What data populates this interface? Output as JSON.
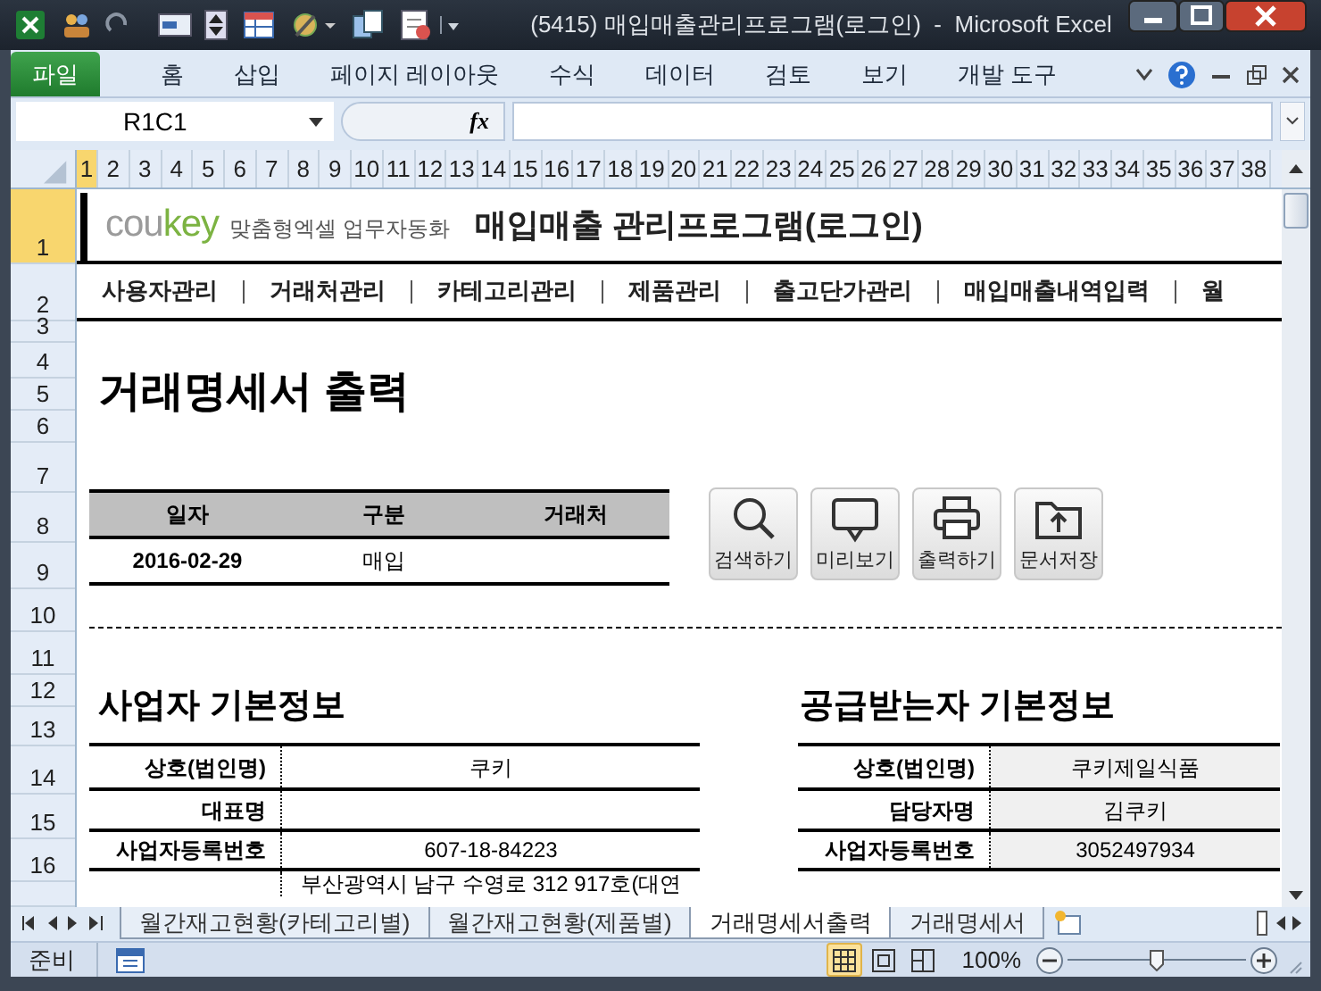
{
  "window": {
    "title": "(5415) 매입매출관리프로그램(로그인)  -  Microsoft Excel"
  },
  "ribbon_tabs": [
    {
      "label": "파일",
      "kind": "file"
    },
    {
      "label": "홈",
      "kind": "tab"
    },
    {
      "label": "삽입",
      "kind": "tab"
    },
    {
      "label": "페이지 레이아웃",
      "kind": "tab"
    },
    {
      "label": "수식",
      "kind": "tab"
    },
    {
      "label": "데이터",
      "kind": "tab"
    },
    {
      "label": "검토",
      "kind": "tab"
    },
    {
      "label": "보기",
      "kind": "tab"
    },
    {
      "label": "개발 도구",
      "kind": "tab"
    }
  ],
  "formula_bar": {
    "name_box": "R1C1",
    "function_label": "fx"
  },
  "column_headers": [
    {
      "label": "1",
      "selected": true
    },
    {
      "label": "2",
      "selected": false
    },
    {
      "label": "3",
      "selected": false
    },
    {
      "label": "4",
      "selected": false
    },
    {
      "label": "5",
      "selected": false
    },
    {
      "label": "6",
      "selected": false
    },
    {
      "label": "7",
      "selected": false
    },
    {
      "label": "8",
      "selected": false
    },
    {
      "label": "9",
      "selected": false
    },
    {
      "label": "10",
      "selected": false
    },
    {
      "label": "11",
      "selected": false
    },
    {
      "label": "12",
      "selected": false
    },
    {
      "label": "13",
      "selected": false
    },
    {
      "label": "14",
      "selected": false
    },
    {
      "label": "15",
      "selected": false
    },
    {
      "label": "16",
      "selected": false
    },
    {
      "label": "17",
      "selected": false
    },
    {
      "label": "18",
      "selected": false
    },
    {
      "label": "19",
      "selected": false
    },
    {
      "label": "20",
      "selected": false
    },
    {
      "label": "21",
      "selected": false
    },
    {
      "label": "22",
      "selected": false
    },
    {
      "label": "23",
      "selected": false
    },
    {
      "label": "24",
      "selected": false
    },
    {
      "label": "25",
      "selected": false
    },
    {
      "label": "26",
      "selected": false
    },
    {
      "label": "27",
      "selected": false
    },
    {
      "label": "28",
      "selected": false
    },
    {
      "label": "29",
      "selected": false
    },
    {
      "label": "30",
      "selected": false
    },
    {
      "label": "31",
      "selected": false
    },
    {
      "label": "32",
      "selected": false
    },
    {
      "label": "33",
      "selected": false
    },
    {
      "label": "34",
      "selected": false
    },
    {
      "label": "35",
      "selected": false
    },
    {
      "label": "36",
      "selected": false
    },
    {
      "label": "37",
      "selected": false
    },
    {
      "label": "38",
      "selected": false
    }
  ],
  "row_headers": [
    {
      "label": "1",
      "selected": true
    },
    {
      "label": "2",
      "selected": false
    },
    {
      "label": "3",
      "selected": false
    },
    {
      "label": "4",
      "selected": false
    },
    {
      "label": "5",
      "selected": false
    },
    {
      "label": "6",
      "selected": false
    },
    {
      "label": "7",
      "selected": false
    },
    {
      "label": "8",
      "selected": false
    },
    {
      "label": "9",
      "selected": false
    },
    {
      "label": "10",
      "selected": false
    },
    {
      "label": "11",
      "selected": false
    },
    {
      "label": "12",
      "selected": false
    },
    {
      "label": "13",
      "selected": false
    },
    {
      "label": "14",
      "selected": false
    },
    {
      "label": "15",
      "selected": false
    },
    {
      "label": "16",
      "selected": false
    }
  ],
  "sheet": {
    "logo": {
      "brand_prefix": "cou",
      "brand_suffix": "key",
      "tagline": "맞춤형엑셀 업무자동화"
    },
    "app_title": "매입매출 관리프로그램(로그인)",
    "nav": [
      "사용자관리",
      "거래처관리",
      "카테고리관리",
      "제품관리",
      "출고단가관리",
      "매입매출내역입력",
      "월"
    ],
    "page_title": "거래명세서 출력",
    "search_table": {
      "columns": [
        "일자",
        "구분",
        "거래처"
      ],
      "values": [
        "2016-02-29",
        "매입"
      ]
    },
    "buttons": [
      {
        "label": "검색하기",
        "kind": "search"
      },
      {
        "label": "미리보기",
        "kind": "preview"
      },
      {
        "label": "출력하기",
        "kind": "print"
      },
      {
        "label": "문서저장",
        "kind": "save"
      }
    ],
    "supplier": {
      "title": "사업자 기본정보",
      "rows": [
        {
          "label": "상호(법인명)",
          "value": "쿠키"
        },
        {
          "label": "대표명"
        },
        {
          "label": "사업자등록번호",
          "value": "607-18-84223"
        },
        {
          "value": "부산광역시 남구 수영로 312 917호(대연"
        }
      ]
    },
    "recipient": {
      "title": "공급받는자 기본정보",
      "rows": [
        {
          "label": "상호(법인명)",
          "value": "쿠키제일식품"
        },
        {
          "label": "담당자명",
          "value": "김쿠키"
        },
        {
          "label": "사업자등록번호",
          "value": "3052497934"
        }
      ]
    }
  },
  "sheet_tabs": [
    {
      "label": "월간재고현황(카테고리별)",
      "selected": false
    },
    {
      "label": "월간재고현황(제품별)",
      "selected": false
    },
    {
      "label": "거래명세서출력",
      "selected": true
    },
    {
      "label": "거래명세서",
      "selected": false
    }
  ],
  "status_bar": {
    "mode": "준비",
    "views": [
      {
        "kind": "normal",
        "selected": true
      },
      {
        "kind": "page_layout",
        "selected": false
      },
      {
        "kind": "page_break",
        "selected": false
      }
    ],
    "zoom": "100%",
    "level": 0.5
  }
}
